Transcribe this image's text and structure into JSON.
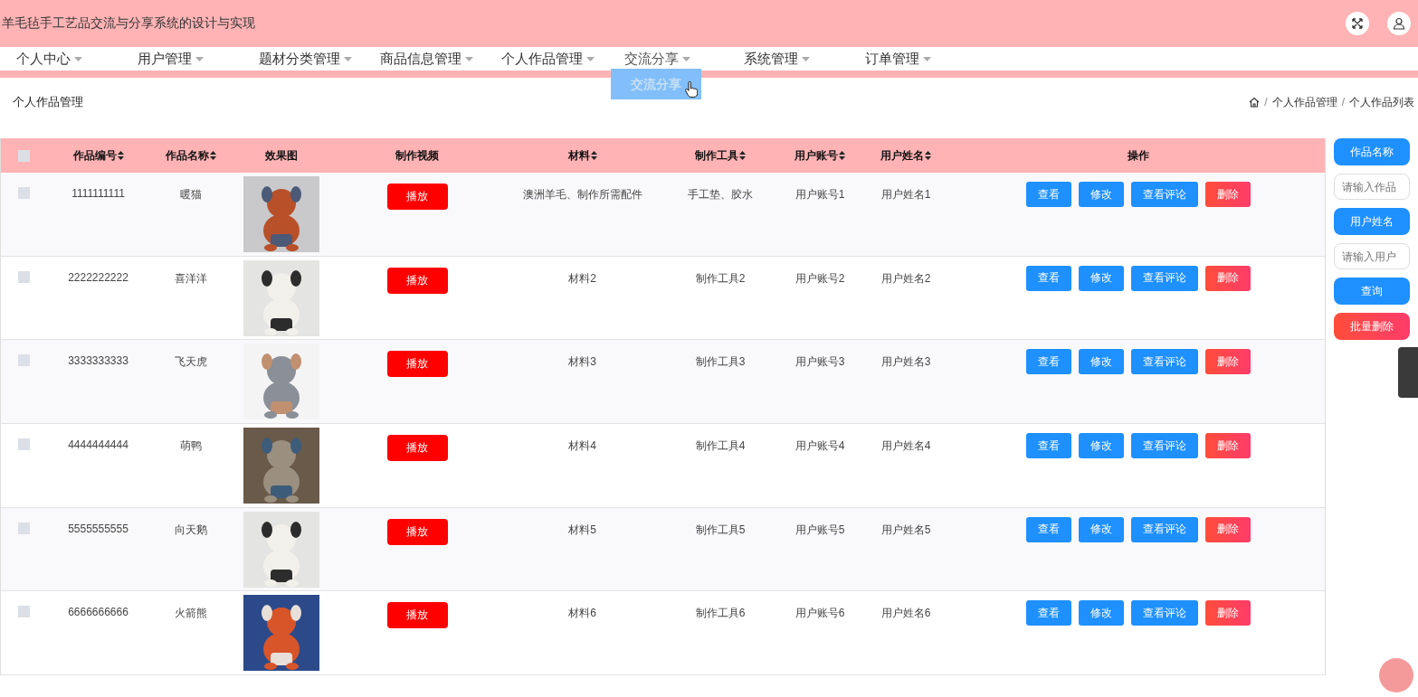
{
  "header": {
    "title": "羊毛毡手工艺品交流与分享系统的设计与实现"
  },
  "nav": [
    {
      "label": "个人中心",
      "selected": false
    },
    {
      "label": "用户管理",
      "selected": false
    },
    {
      "label": "题材分类管理",
      "selected": false
    },
    {
      "label": "商品信息管理",
      "selected": false
    },
    {
      "label": "个人作品管理",
      "selected": false
    },
    {
      "label": "交流分享",
      "selected": true
    },
    {
      "label": "系统管理",
      "selected": false
    },
    {
      "label": "订单管理",
      "selected": false
    }
  ],
  "dropdown": {
    "items": [
      "交流分享"
    ]
  },
  "page_title": "个人作品管理",
  "breadcrumb": [
    {
      "kind": "separator",
      "text": "/"
    },
    {
      "kind": "link",
      "text": "个人作品管理"
    },
    {
      "kind": "separator",
      "text": "/"
    },
    {
      "kind": "link",
      "text": "个人作品列表"
    }
  ],
  "table": {
    "header_checked": false,
    "columns": [
      {
        "label": "作品编号",
        "sortable": true
      },
      {
        "label": "作品名称",
        "sortable": true
      },
      {
        "label": "效果图",
        "sortable": false
      },
      {
        "label": "制作视频",
        "sortable": false
      },
      {
        "label": "材料",
        "sortable": true
      },
      {
        "label": "制作工具",
        "sortable": true
      },
      {
        "label": "用户账号",
        "sortable": true
      },
      {
        "label": "用户姓名",
        "sortable": true
      },
      {
        "label": "操作",
        "sortable": false
      }
    ],
    "rows": [
      {
        "checked": false,
        "id": "1111111111",
        "name": "暖猫",
        "video": "播放",
        "material": "澳洲羊毛、制作所需配件",
        "tool": "手工垫、胶水",
        "account": "用户账号1",
        "user": "用户姓名1",
        "actions": [
          "查看",
          "修改",
          "查看评论",
          "删除"
        ]
      },
      {
        "checked": false,
        "id": "2222222222",
        "name": "喜洋洋",
        "video": "播放",
        "material": "材料2",
        "tool": "制作工具2",
        "account": "用户账号2",
        "user": "用户姓名2",
        "actions": [
          "查看",
          "修改",
          "查看评论",
          "删除"
        ]
      },
      {
        "checked": false,
        "id": "3333333333",
        "name": "飞天虎",
        "video": "播放",
        "material": "材料3",
        "tool": "制作工具3",
        "account": "用户账号3",
        "user": "用户姓名3",
        "actions": [
          "查看",
          "修改",
          "查看评论",
          "删除"
        ]
      },
      {
        "checked": false,
        "id": "4444444444",
        "name": "萌鸭",
        "video": "播放",
        "material": "材料4",
        "tool": "制作工具4",
        "account": "用户账号4",
        "user": "用户姓名4",
        "actions": [
          "查看",
          "修改",
          "查看评论",
          "删除"
        ]
      },
      {
        "checked": false,
        "id": "5555555555",
        "name": "向天鹅",
        "video": "播放",
        "material": "材料5",
        "tool": "制作工具5",
        "account": "用户账号5",
        "user": "用户姓名5",
        "actions": [
          "查看",
          "修改",
          "查看评论",
          "删除"
        ]
      },
      {
        "checked": false,
        "id": "6666666666",
        "name": "火箭熊",
        "video": "播放",
        "material": "材料6",
        "tool": "制作工具6",
        "account": "用户账号6",
        "user": "用户姓名6",
        "actions": [
          "查看",
          "修改",
          "查看评论",
          "删除"
        ]
      }
    ]
  },
  "search": {
    "fields": [
      {
        "label": "作品名称",
        "placeholder": "请输入作品"
      },
      {
        "label": "用户姓名",
        "placeholder": "请输入用户"
      }
    ],
    "query": "查询",
    "batch_delete": "批量删除"
  }
}
